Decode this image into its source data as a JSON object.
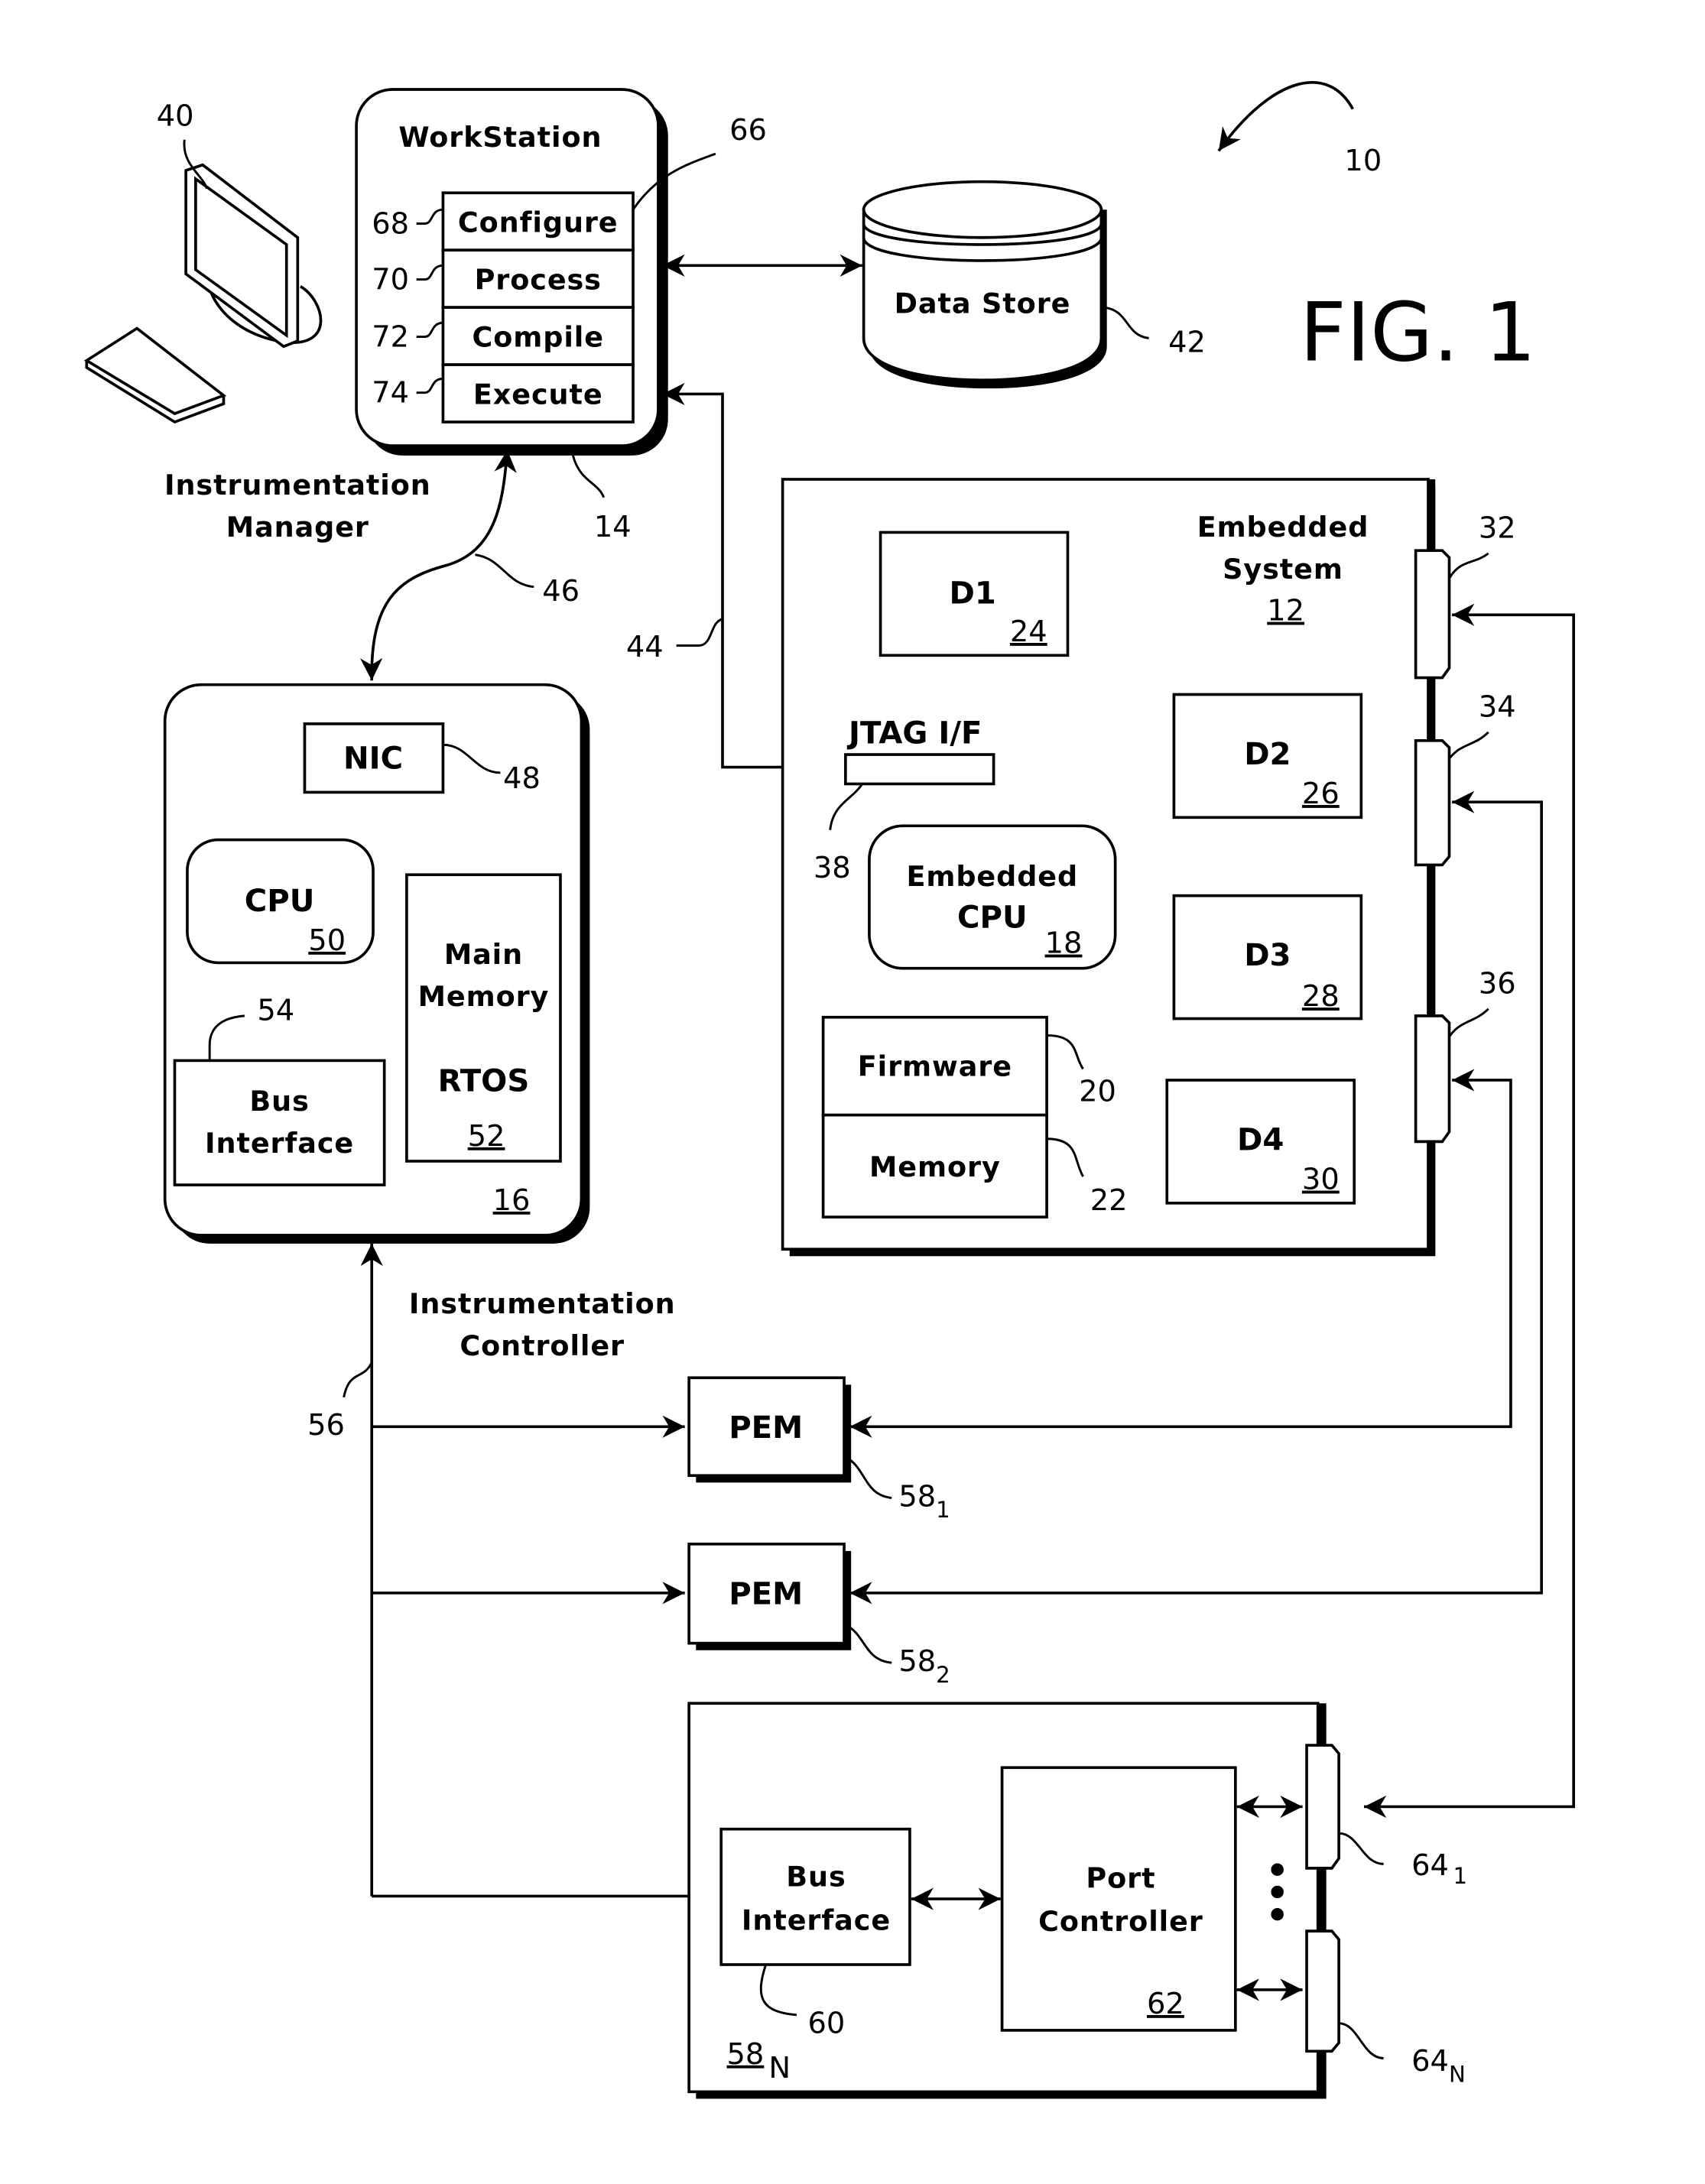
{
  "figure": {
    "title": "FIG. 1",
    "system_ref": "10"
  },
  "workstation": {
    "title": "WorkStation",
    "ref": "14",
    "modules_ref": "66",
    "modules": [
      {
        "label": "Configure",
        "ref": "68"
      },
      {
        "label": "Process",
        "ref": "70"
      },
      {
        "label": "Compile",
        "ref": "72"
      },
      {
        "label": "Execute",
        "ref": "74"
      }
    ]
  },
  "computer": {
    "ref": "40",
    "icon": "desktop-computer-icon"
  },
  "instrumentation_manager": {
    "label_line1": "Instrumentation",
    "label_line2": "Manager"
  },
  "data_store": {
    "label": "Data Store",
    "ref": "42",
    "icon": "database-cylinder-icon"
  },
  "links": {
    "manager_controller": "46",
    "jtag_link": "44",
    "controller_bus": "56"
  },
  "controller": {
    "ref": "16",
    "nic": {
      "label": "NIC",
      "ref": "48"
    },
    "cpu": {
      "label": "CPU",
      "ref": "50"
    },
    "bus_interface": {
      "line1": "Bus",
      "line2": "Interface",
      "ref": "54"
    },
    "main_memory": {
      "line1": "Main",
      "line2": "Memory",
      "line3": "RTOS",
      "ref": "52"
    }
  },
  "instrumentation_controller": {
    "label_line1": "Instrumentation",
    "label_line2": "Controller"
  },
  "embedded_system": {
    "title_line1": "Embedded",
    "title_line2": "System",
    "ref": "12",
    "jtag": {
      "label": "JTAG I/F",
      "ref": "38"
    },
    "cpu": {
      "line1": "Embedded",
      "line2": "CPU",
      "ref": "18"
    },
    "firmware": {
      "label": "Firmware",
      "ref": "20"
    },
    "memory": {
      "label": "Memory",
      "ref": "22"
    },
    "devices": [
      {
        "label": "D1",
        "ref": "24"
      },
      {
        "label": "D2",
        "ref": "26"
      },
      {
        "label": "D3",
        "ref": "28"
      },
      {
        "label": "D4",
        "ref": "30"
      }
    ],
    "ports": [
      {
        "ref": "32"
      },
      {
        "ref": "34"
      },
      {
        "ref": "36"
      }
    ]
  },
  "pems": [
    {
      "label": "PEM",
      "ref": "58",
      "sub": "1"
    },
    {
      "label": "PEM",
      "ref": "58",
      "sub": "2"
    }
  ],
  "pem_n": {
    "ref": "58",
    "sub": "N",
    "bus_interface": {
      "line1": "Bus",
      "line2": "Interface",
      "ref": "60"
    },
    "port_controller": {
      "line1": "Port",
      "line2": "Controller",
      "ref": "62"
    },
    "ports": [
      {
        "ref": "64",
        "sub": "1"
      },
      {
        "ref": "64",
        "sub": "N"
      }
    ]
  }
}
